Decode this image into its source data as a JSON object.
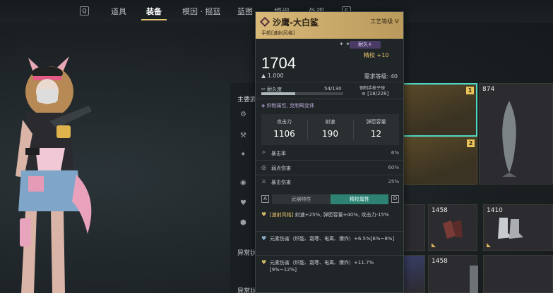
{
  "nav": {
    "key_left": "Q",
    "key_right": "E",
    "tabs": [
      "道具",
      "装备",
      "模因 · 摇篮",
      "蓝图",
      "模组",
      "外观"
    ],
    "active_index": 1
  },
  "left_panel": {
    "section_main": "主要武",
    "section_abnormal": "异常状",
    "section_bottom": "异常状"
  },
  "tooltip": {
    "title": "沙鹰-大白鲨",
    "subtitle": "手枪[速射风格]",
    "craft_level_label": "工艺等级",
    "craft_level_value": "V",
    "durable_tag": "耐久+",
    "refine": "精校 +10",
    "power": "1704",
    "weight": "1.000",
    "required_level": "需求等级: 40",
    "durability_label": "耐久度",
    "durability_value": "54/130",
    "durability_fraction": 0.415,
    "ammo_label": "钢制手枪子弹",
    "ammo_value": "[18/228]",
    "trait": "抑制属性, 克制畸变体",
    "stats": [
      {
        "label": "攻击力",
        "value": "1106"
      },
      {
        "label": "射速",
        "value": "190"
      },
      {
        "label": "弹匣容量",
        "value": "12"
      }
    ],
    "attributes": [
      {
        "label": "暴击率",
        "value": "6%"
      },
      {
        "label": "弱点伤害",
        "value": "60%"
      },
      {
        "label": "暴击伤害",
        "value": "25%"
      }
    ],
    "tab_key_left": "A",
    "tab_key_right": "D",
    "tab_weapon": "武器特性",
    "tab_refine": "精校属性",
    "mods": [
      {
        "highlight": "[速射风格]",
        "text": " 射速+25%, 弹匣容量+40%, 攻击力-15%"
      },
      {
        "highlight": "",
        "text": "元素伤害（炽能、霜寒、电离、爆炸）+6.5%[6%~8%]"
      },
      {
        "highlight": "",
        "text": "元素伤害（炽能、霜寒、电离、爆炸）+11.7%[9%~12%]"
      }
    ]
  },
  "inventory": {
    "slots": [
      {
        "badge": "1",
        "label": ""
      },
      {
        "badge": "2",
        "label": ""
      },
      {
        "badge": "",
        "label": "874"
      },
      {
        "badge": "",
        "label": "1458"
      },
      {
        "badge": "",
        "label": "1410"
      },
      {
        "badge": "",
        "label": "1458"
      }
    ]
  }
}
